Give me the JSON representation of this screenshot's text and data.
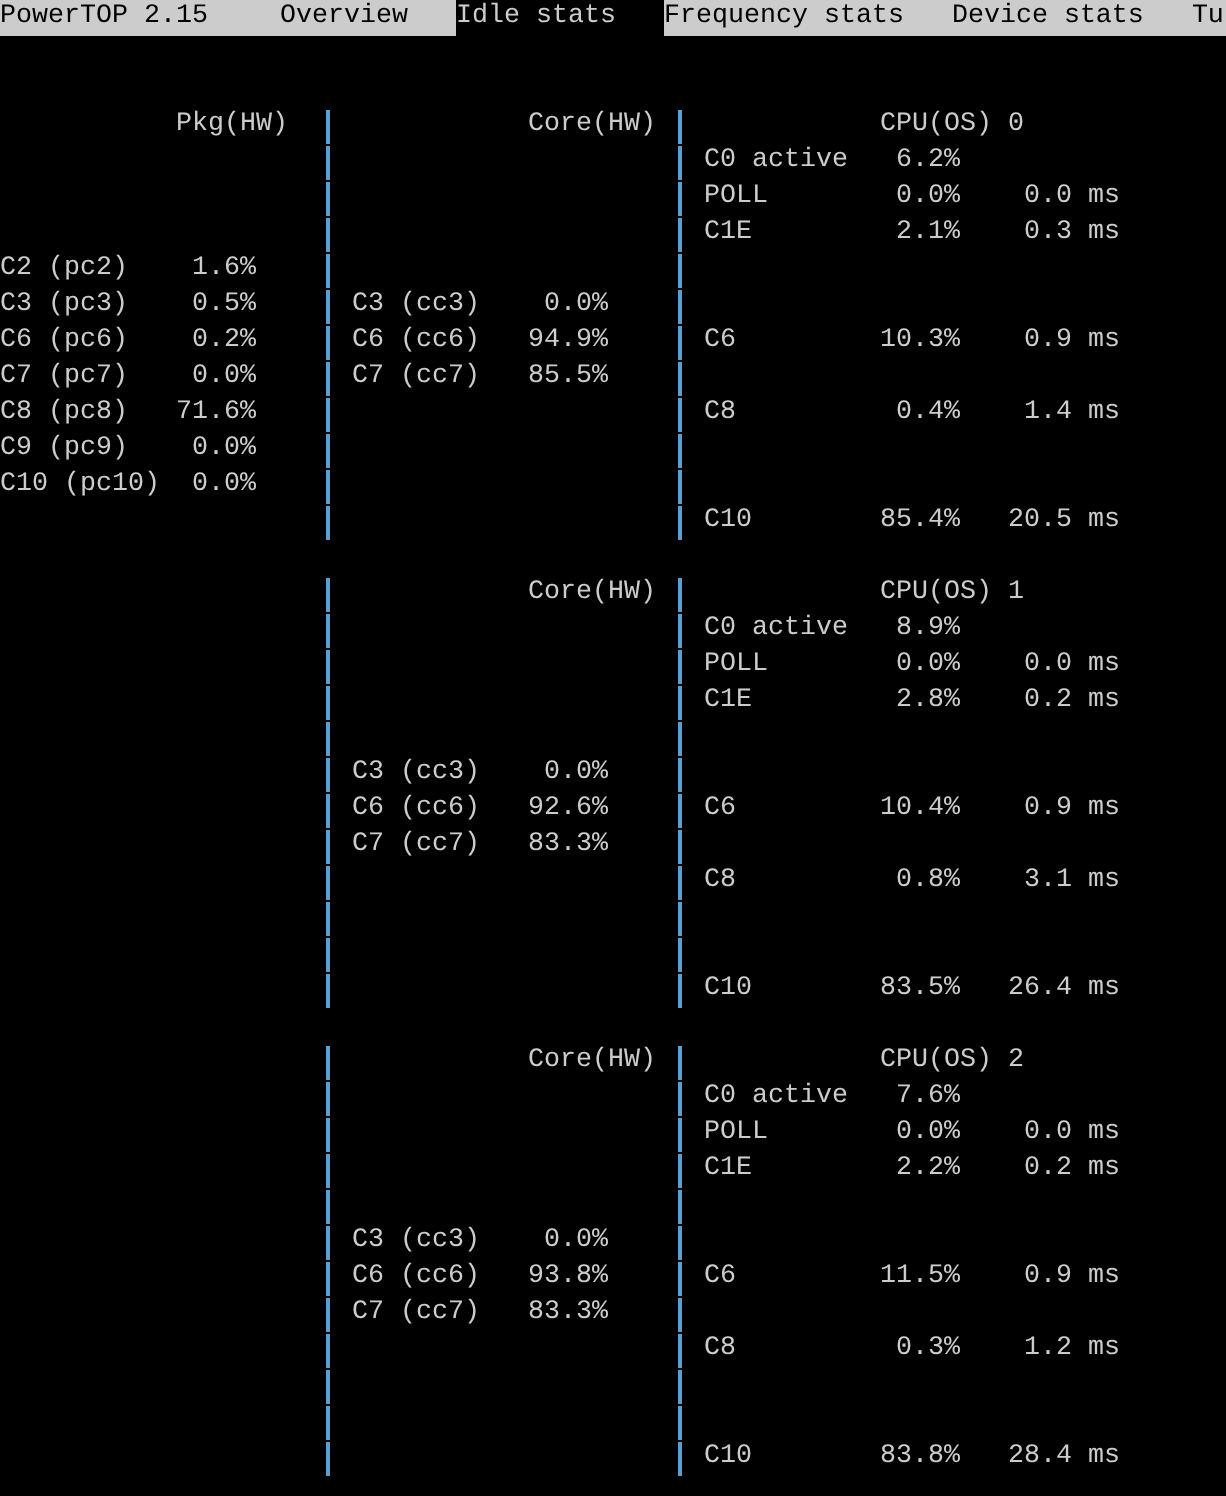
{
  "app": {
    "title": "PowerTOP 2.15"
  },
  "tabs": [
    {
      "label": "Overview",
      "selected": false
    },
    {
      "label": "Idle stats",
      "selected": true
    },
    {
      "label": "Frequency stats",
      "selected": false
    },
    {
      "label": "Device stats",
      "selected": false
    },
    {
      "label": "Tu",
      "selected": false
    }
  ],
  "blocks": [
    {
      "header": {
        "package": "Pkg(HW)",
        "core": "Core(HW)",
        "cpu": "CPU(OS) 0"
      },
      "lines": [
        {
          "kind": "states",
          "cpu": {
            "state": "C0 active",
            "percent": "6.2%"
          }
        },
        {
          "kind": "states",
          "cpu": {
            "state": "POLL",
            "percent": "0.0%",
            "time": "0.0 ms"
          }
        },
        {
          "kind": "states",
          "cpu": {
            "state": "C1E",
            "percent": "2.1%",
            "time": "0.3 ms"
          }
        },
        {
          "kind": "states",
          "package": {
            "state": "C2 (pc2)",
            "percent": "1.6%"
          }
        },
        {
          "kind": "states",
          "package": {
            "state": "C3 (pc3)",
            "percent": "0.5%"
          },
          "core": {
            "state": "C3 (cc3)",
            "percent": "0.0%"
          }
        },
        {
          "kind": "states",
          "package": {
            "state": "C6 (pc6)",
            "percent": "0.2%"
          },
          "core": {
            "state": "C6 (cc6)",
            "percent": "94.9%"
          },
          "cpu": {
            "state": "C6",
            "percent": "10.3%",
            "time": "0.9 ms"
          }
        },
        {
          "kind": "states",
          "package": {
            "state": "C7 (pc7)",
            "percent": "0.0%"
          },
          "core": {
            "state": "C7 (cc7)",
            "percent": "85.5%"
          }
        },
        {
          "kind": "states",
          "package": {
            "state": "C8 (pc8)",
            "percent": "71.6%"
          },
          "cpu": {
            "state": "C8",
            "percent": "0.4%",
            "time": "1.4 ms"
          }
        },
        {
          "kind": "states",
          "package": {
            "state": "C9 (pc9)",
            "percent": "0.0%"
          }
        },
        {
          "kind": "states",
          "package": {
            "state": "C10 (pc10)",
            "percent": "0.0%"
          }
        },
        {
          "kind": "states",
          "cpu": {
            "state": "C10",
            "percent": "85.4%",
            "time": "20.5 ms"
          }
        }
      ]
    },
    {
      "header": {
        "core": "Core(HW)",
        "cpu": "CPU(OS) 1"
      },
      "lines": [
        {
          "kind": "states",
          "cpu": {
            "state": "C0 active",
            "percent": "8.9%"
          }
        },
        {
          "kind": "states",
          "cpu": {
            "state": "POLL",
            "percent": "0.0%",
            "time": "0.0 ms"
          }
        },
        {
          "kind": "states",
          "cpu": {
            "state": "C1E",
            "percent": "2.8%",
            "time": "0.2 ms"
          }
        },
        {
          "kind": "blank"
        },
        {
          "kind": "states",
          "core": {
            "state": "C3 (cc3)",
            "percent": "0.0%"
          }
        },
        {
          "kind": "states",
          "core": {
            "state": "C6 (cc6)",
            "percent": "92.6%"
          },
          "cpu": {
            "state": "C6",
            "percent": "10.4%",
            "time": "0.9 ms"
          }
        },
        {
          "kind": "states",
          "core": {
            "state": "C7 (cc7)",
            "percent": "83.3%"
          }
        },
        {
          "kind": "states",
          "cpu": {
            "state": "C8",
            "percent": "0.8%",
            "time": "3.1 ms"
          }
        },
        {
          "kind": "blank"
        },
        {
          "kind": "blank"
        },
        {
          "kind": "states",
          "cpu": {
            "state": "C10",
            "percent": "83.5%",
            "time": "26.4 ms"
          }
        }
      ]
    },
    {
      "header": {
        "core": "Core(HW)",
        "cpu": "CPU(OS) 2"
      },
      "lines": [
        {
          "kind": "states",
          "cpu": {
            "state": "C0 active",
            "percent": "7.6%"
          }
        },
        {
          "kind": "states",
          "cpu": {
            "state": "POLL",
            "percent": "0.0%",
            "time": "0.0 ms"
          }
        },
        {
          "kind": "states",
          "cpu": {
            "state": "C1E",
            "percent": "2.2%",
            "time": "0.2 ms"
          }
        },
        {
          "kind": "blank"
        },
        {
          "kind": "states",
          "core": {
            "state": "C3 (cc3)",
            "percent": "0.0%"
          }
        },
        {
          "kind": "states",
          "core": {
            "state": "C6 (cc6)",
            "percent": "93.8%"
          },
          "cpu": {
            "state": "C6",
            "percent": "11.5%",
            "time": "0.9 ms"
          }
        },
        {
          "kind": "states",
          "core": {
            "state": "C7 (cc7)",
            "percent": "83.3%"
          }
        },
        {
          "kind": "states",
          "cpu": {
            "state": "C8",
            "percent": "0.3%",
            "time": "1.2 ms"
          }
        },
        {
          "kind": "blank"
        },
        {
          "kind": "blank"
        },
        {
          "kind": "states",
          "cpu": {
            "state": "C10",
            "percent": "83.8%",
            "time": "28.4 ms"
          }
        }
      ]
    }
  ]
}
